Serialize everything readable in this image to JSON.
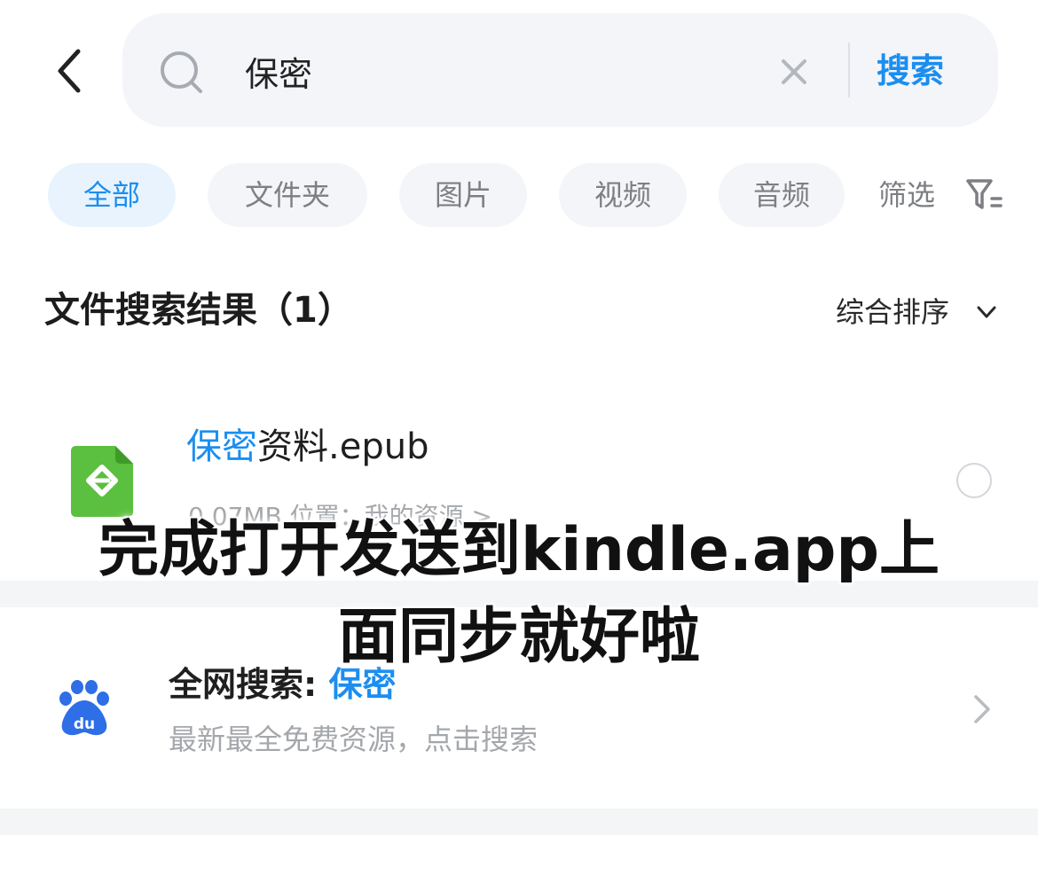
{
  "search": {
    "value": "保密",
    "submit_label": "搜索"
  },
  "filters": {
    "chips": [
      {
        "label": "全部"
      },
      {
        "label": "文件夹"
      },
      {
        "label": "图片"
      },
      {
        "label": "视频"
      },
      {
        "label": "音频"
      }
    ],
    "screen_label": "筛选",
    "active_index": 0
  },
  "results": {
    "title": "文件搜索结果（1）",
    "sort_label": "综合排序",
    "files": [
      {
        "name_highlight": "保密",
        "name_rest": "资料.epub",
        "meta": "0.07MB    位置：我的资源 >"
      }
    ]
  },
  "web_search": {
    "title_prefix": "全网搜索: ",
    "title_keyword": "保密",
    "subtitle": "最新最全免费资源，点击搜索",
    "icon_text": "du"
  },
  "overlay_caption": {
    "line1": "完成打开发送到kindle.app上",
    "line2": "面同步就好啦"
  },
  "colors": {
    "accent": "#1b8ef0",
    "epub_green": "#5bbf3f",
    "baidu_blue": "#2e6ee6"
  }
}
